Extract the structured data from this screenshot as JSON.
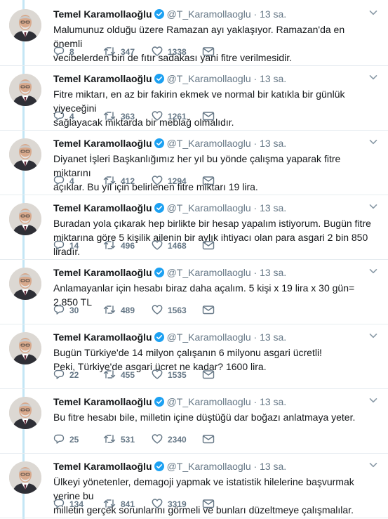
{
  "author": {
    "name": "Temel Karamollaoğlu",
    "handle": "@T_Karamollaoglu",
    "sep": "·",
    "time": "13 sa."
  },
  "tweets": [
    {
      "text": "Malumunuz olduğu üzere Ramazan ayı yaklaşıyor. Ramazan'da en önemli\nvecibelerden biri de fıtır sadakası yani fitre verilmesidir.",
      "replies": "8",
      "retweets": "347",
      "likes": "1338"
    },
    {
      "text": "Fitre miktarı, en az bir fakirin ekmek ve normal bir katıkla bir günlük yiyeceğini\nsağlayacak miktarda bir meblağ olmalıdır.",
      "replies": "4",
      "retweets": "363",
      "likes": "1261"
    },
    {
      "text": "Diyanet İşleri Başkanlığımız her yıl bu yönde çalışma yaparak fitre miktarını\naçıklar. Bu yıl için belirlenen fitre miktarı 19 lira.",
      "replies": "4",
      "retweets": "412",
      "likes": "1294"
    },
    {
      "text": "Buradan yola çıkarak hep birlikte bir hesap yapalım istiyorum. Bugün fitre\nmiktarına göre 5 kişilik ailenin bir aylık ihtiyacı olan para asgari 2 bin 850 liradır.",
      "replies": "14",
      "retweets": "496",
      "likes": "1468"
    },
    {
      "text": "Anlamayanlar için hesabı biraz daha açalım. 5 kişi x 19 lira x 30 gün= 2.850 TL",
      "replies": "30",
      "retweets": "489",
      "likes": "1563"
    },
    {
      "text": "Bugün Türkiye'de 14 milyon çalışanın 6 milyonu asgari ücretli!\nPeki, Türkiye'de asgari ücret ne kadar? 1600 lira.",
      "replies": "22",
      "retweets": "455",
      "likes": "1535"
    },
    {
      "text": "Bu fitre hesabı bile, milletin içine düştüğü dar boğazı anlatmaya yeter.",
      "replies": "25",
      "retweets": "531",
      "likes": "2340"
    },
    {
      "text": "Ülkeyi yönetenler, demagoji yapmak ve istatistik hilelerine başvurmak yerine bu\nmilletin gerçek sorunlarını görmeli ve bunları düzeltmeye çalışmalılar.",
      "replies": "134",
      "retweets": "841",
      "likes": "3319"
    }
  ],
  "icons": {
    "verified": "verified-badge-icon",
    "reply": "reply-icon",
    "retweet": "retweet-icon",
    "like": "like-icon",
    "dm": "envelope-icon",
    "caret": "chevron-down-icon"
  },
  "colors": {
    "verified": "#1da1f2",
    "thread_line": "#c4e6f5",
    "muted": "#657786",
    "divider": "#e6ecf0"
  }
}
